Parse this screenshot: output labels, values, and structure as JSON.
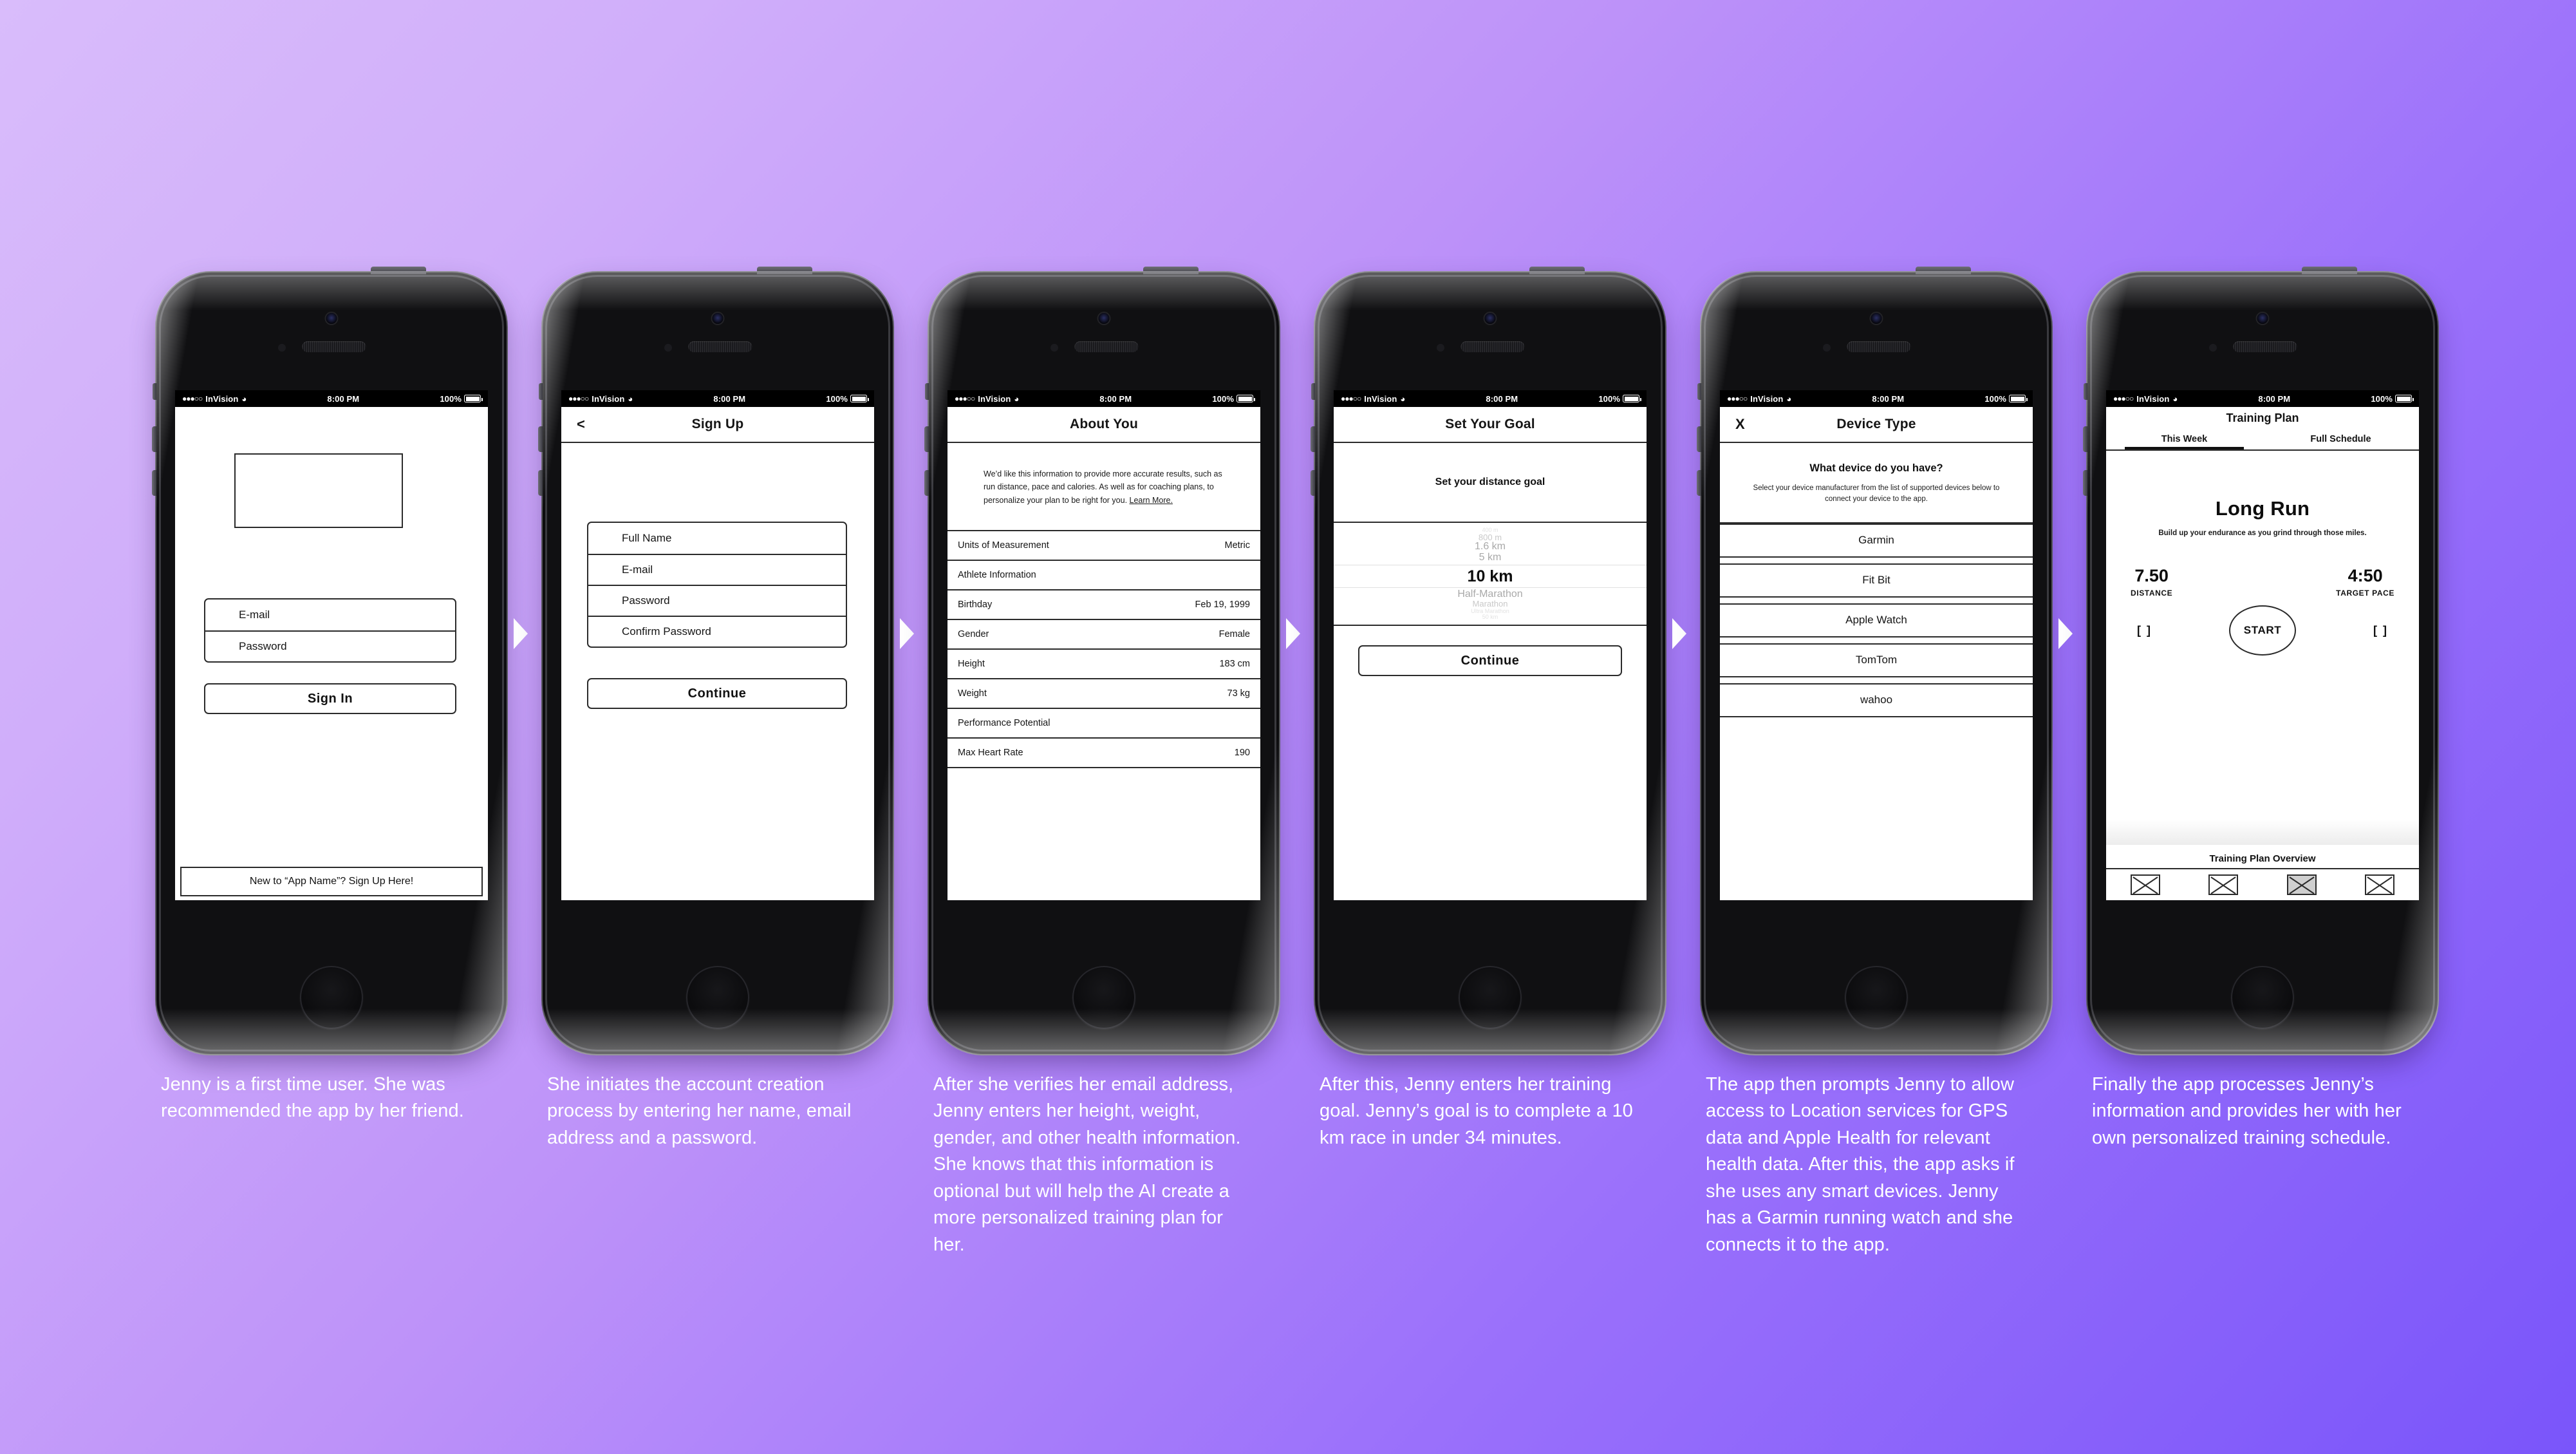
{
  "background": {
    "gradient_from": "#d9bcfb",
    "gradient_to": "#7a55fa"
  },
  "status_bar": {
    "dots": "●●●○○",
    "carrier": "InVision",
    "wifi_icon": "wifi-icon",
    "time": "8:00 PM",
    "battery_percent": "100%"
  },
  "arrow_icon": "chevron-right-arrow-icon",
  "screens": [
    {
      "id": "sign-in",
      "navbar": {
        "title": "",
        "left": ""
      },
      "logo_placeholder": "logo-placeholder",
      "fields": [
        {
          "label": "E-mail"
        },
        {
          "label": "Password"
        }
      ],
      "primary_button": "Sign In",
      "footer_link": "New to “App Name”? Sign Up Here!",
      "caption": "Jenny is a first time user. She was recommended the app by her friend."
    },
    {
      "id": "sign-up",
      "navbar": {
        "title": "Sign Up",
        "left": "<"
      },
      "fields": [
        {
          "label": "Full Name"
        },
        {
          "label": "E-mail"
        },
        {
          "label": "Password"
        },
        {
          "label": "Confirm Password"
        }
      ],
      "primary_button": "Continue",
      "caption": "She initiates the account creation process by entering her name, email address and a password."
    },
    {
      "id": "about-you",
      "navbar": {
        "title": "About You",
        "left": ""
      },
      "blurb": "We’d like this information to provide more accurate results, such as run distance, pace and calories. As well as for coaching plans, to personalize your plan to be right for you.",
      "blurb_link": "Learn More.",
      "rows": [
        {
          "label": "Units of Measurement",
          "value": "Metric"
        },
        {
          "label": "Athlete Information",
          "value": ""
        },
        {
          "label": "Birthday",
          "value": "Feb 19, 1999"
        },
        {
          "label": "Gender",
          "value": "Female"
        },
        {
          "label": "Height",
          "value": "183 cm"
        },
        {
          "label": "Weight",
          "value": "73 kg"
        },
        {
          "label": "Performance Potential",
          "value": ""
        },
        {
          "label": "Max Heart Rate",
          "value": "190"
        }
      ],
      "caption": "After she verifies her email address, Jenny enters her height, weight, gender, and other health information. She knows that this information is optional but will help the AI create a more personalized training plan for her."
    },
    {
      "id": "set-your-goal",
      "navbar": {
        "title": "Set Your Goal",
        "left": ""
      },
      "prompt": "Set your distance goal",
      "picker": {
        "options": [
          "400 m",
          "800 m",
          "1.6 km",
          "5 km",
          "10 km",
          "Half-Marathon",
          "Marathon",
          "Ultra Marathon",
          "50 km"
        ],
        "selected": "10 km",
        "selected_index": 4
      },
      "primary_button": "Continue",
      "caption": "After this, Jenny enters her training goal. Jenny’s goal is to complete a 10 km race in under 34 minutes."
    },
    {
      "id": "device-type",
      "navbar": {
        "title": "Device Type",
        "left": "X"
      },
      "question": "What device do you have?",
      "subtext": "Select your device manufacturer from the list of supported devices below to connect your device to the app.",
      "devices": [
        "Garmin",
        "Fit Bit",
        "Apple Watch",
        "TomTom",
        "wahoo"
      ],
      "caption": "The app then prompts Jenny to allow access to Location services for GPS data and Apple Health for relevant health data. After this, the app asks if she uses any smart devices. Jenny has a Garmin running watch and she connects it to the app."
    },
    {
      "id": "training-plan",
      "navbar": {
        "title": "Training Plan",
        "left": ""
      },
      "tabs": [
        {
          "label": "This Week",
          "active": true
        },
        {
          "label": "Full Schedule",
          "active": false
        }
      ],
      "workout_title": "Long Run",
      "workout_subtitle": "Build up your endurance as you grind through those miles.",
      "stats": [
        {
          "value": "7.50",
          "label": "DISTANCE"
        },
        {
          "value": "4:50",
          "label": "TARGET PACE"
        }
      ],
      "left_bracket": "[ ]",
      "right_bracket": "[ ]",
      "start_button": "START",
      "overview_label": "Training Plan Overview",
      "tabbar_icons": [
        "placeholder-icon",
        "placeholder-icon",
        "placeholder-icon-active",
        "placeholder-icon"
      ],
      "caption": "Finally the app processes Jenny’s information and provides her with her own personalized training schedule."
    }
  ]
}
